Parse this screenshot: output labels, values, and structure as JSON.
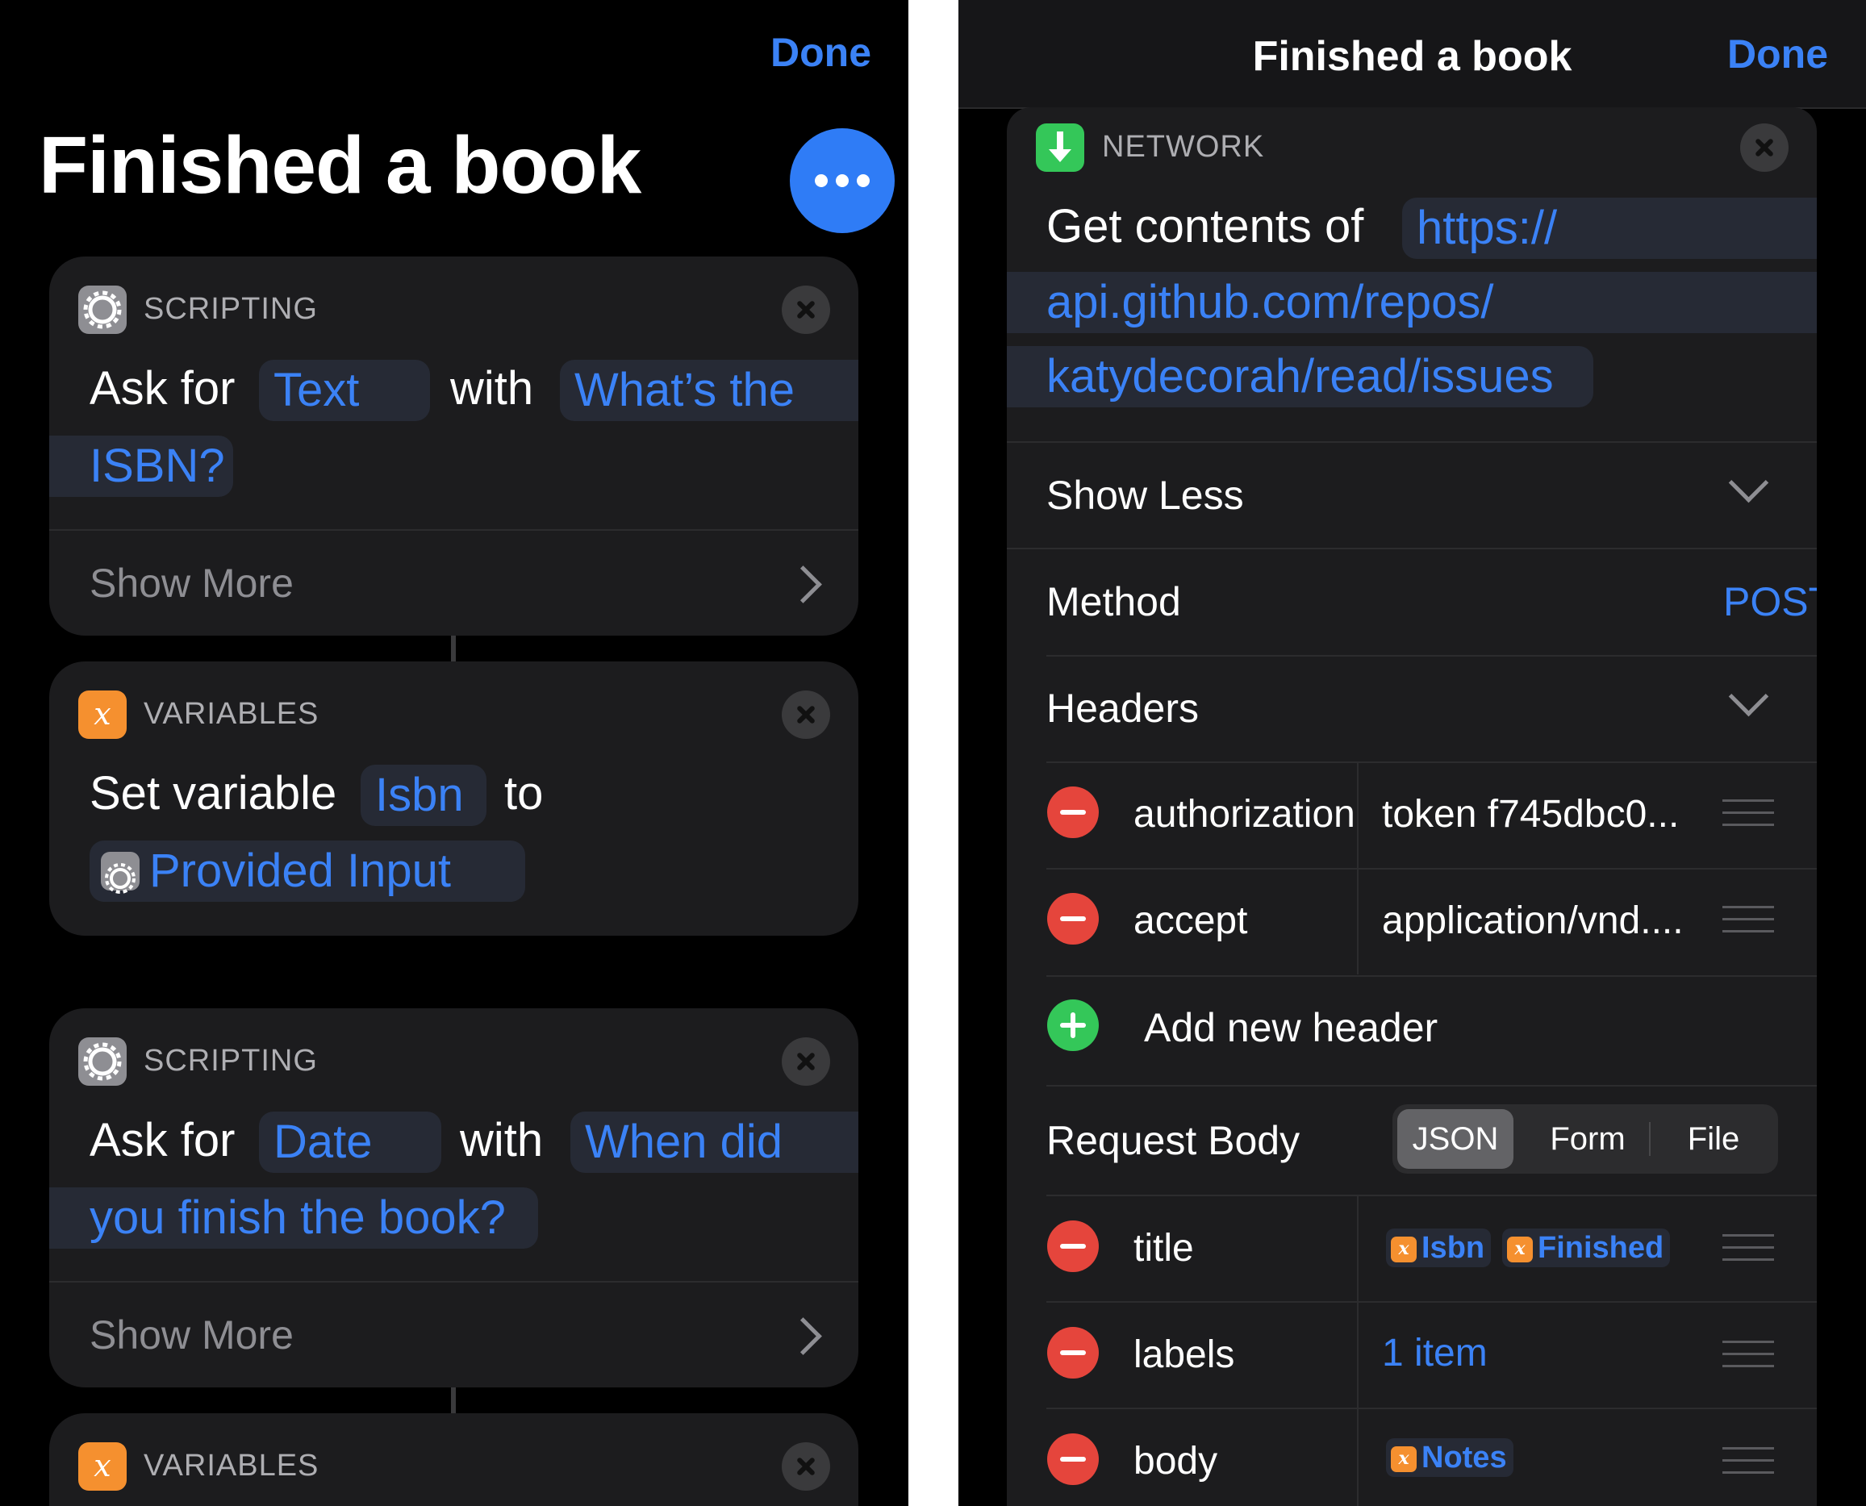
{
  "left": {
    "done_label": "Done",
    "title": "Finished a book",
    "more_icon": "ellipsis-icon",
    "cards": [
      {
        "category": "SCRIPTING",
        "icon": "gear-icon",
        "line1": [
          "Ask for",
          "Text",
          "with",
          "What’s the"
        ],
        "line2": "ISBN?",
        "footer": "Show More"
      },
      {
        "category": "VARIABLES",
        "icon": "variable-icon",
        "line1": [
          "Set variable",
          "Isbn",
          "to"
        ],
        "line2": "Provided Input"
      },
      {
        "category": "SCRIPTING",
        "icon": "gear-icon",
        "line1": [
          "Ask for",
          "Date",
          "with",
          "When did"
        ],
        "line2": "you finish the book?",
        "footer": "Show More"
      },
      {
        "category": "VARIABLES",
        "icon": "variable-icon"
      }
    ]
  },
  "right": {
    "nav_title": "Finished a book",
    "done_label": "Done",
    "card": {
      "category": "NETWORK",
      "icon": "download-arrow-icon",
      "prefix": "Get contents of",
      "url_lines": [
        "https://",
        "api.github.com/repos/",
        "katydecorah/read/issues"
      ],
      "show_less": "Show Less",
      "method_label": "Method",
      "method_value": "POST",
      "headers_label": "Headers",
      "headers": [
        {
          "key": "authorization",
          "value": "token f745dbc0..."
        },
        {
          "key": "accept",
          "value": "application/vnd...."
        }
      ],
      "add_header": "Add new header",
      "body_label": "Request Body",
      "body_tabs": [
        "JSON",
        "Form",
        "File"
      ],
      "body_tab_selected": "JSON",
      "body_rows": [
        {
          "key": "title",
          "tokens": [
            "Isbn",
            "Finished"
          ]
        },
        {
          "key": "labels",
          "value": "1 item"
        },
        {
          "key": "body",
          "tokens": [
            "Notes"
          ]
        }
      ],
      "var_glyph": "x"
    }
  },
  "colors": {
    "accent": "#3b82f6",
    "card": "#1c1c1e",
    "remove": "#e5453c",
    "add": "#34c759",
    "variable": "#f5902f"
  }
}
